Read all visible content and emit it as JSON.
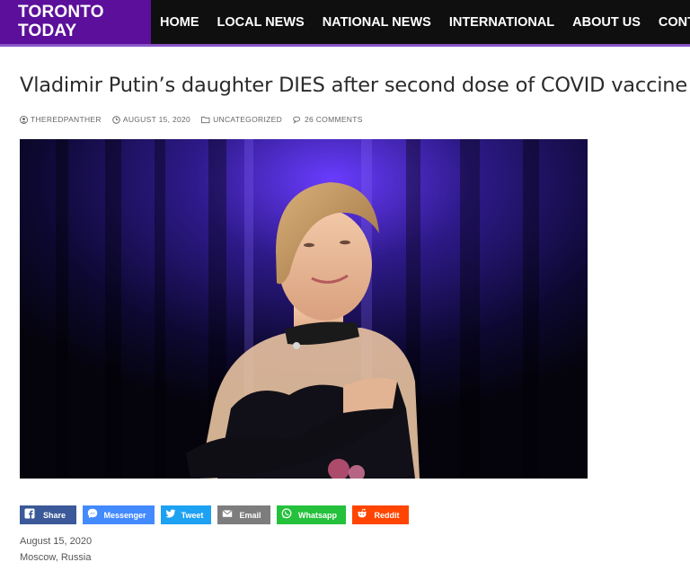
{
  "brand": {
    "line1": "TORONTO",
    "line2": "TODAY"
  },
  "nav": [
    "HOME",
    "LOCAL NEWS",
    "NATIONAL NEWS",
    "INTERNATIONAL",
    "ABOUT US",
    "CONTACT"
  ],
  "article": {
    "title": "Vladimir Putin’s daughter DIES after second dose of COVID vaccine",
    "meta": {
      "author": "THEREDPANTHER",
      "date": "AUGUST 15, 2020",
      "category": "UNCATEGORIZED",
      "comments": "26 COMMENTS"
    },
    "dateline": "August 15, 2020",
    "location": "Moscow, Russia"
  },
  "share": {
    "facebook": "Share",
    "messenger": "Messenger",
    "twitter": "Tweet",
    "email": "Email",
    "whatsapp": "Whatsapp",
    "reddit": "Reddit"
  },
  "colors": {
    "brand_bg": "#5b0f9a",
    "nav_bg": "#0f0f0f",
    "facebook": "#3b5998",
    "messenger": "#448aff",
    "twitter": "#1da1f2",
    "email": "#7d7d7d",
    "whatsapp": "#25c13c",
    "reddit": "#ff4500"
  }
}
